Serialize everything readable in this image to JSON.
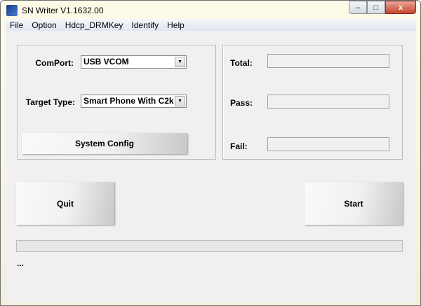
{
  "window": {
    "title": "SN Writer V1.1632.00",
    "minimize": "–",
    "maximize": "□",
    "close": "x"
  },
  "menu": [
    "File",
    "Option",
    "Hdcp_DRMKey",
    "Identify",
    "Help"
  ],
  "config": {
    "comport_label": "ComPort:",
    "comport_value": "USB VCOM",
    "target_label": "Target Type:",
    "target_value": "Smart Phone With C2k",
    "system_config": "System Config"
  },
  "stats": {
    "total_label": "Total:",
    "pass_label": "Pass:",
    "fail_label": "Fail:",
    "total": "",
    "pass": "",
    "fail": ""
  },
  "buttons": {
    "quit": "Quit",
    "start": "Start"
  },
  "progress": {
    "value": 0
  },
  "status": "..."
}
